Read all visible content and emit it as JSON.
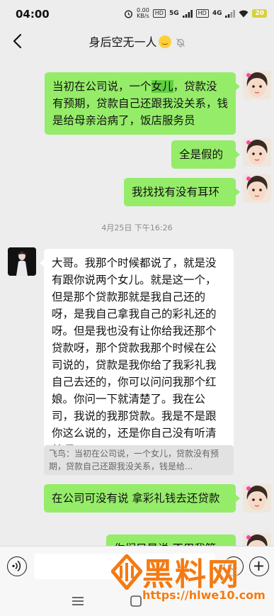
{
  "status": {
    "time": "04:00",
    "net_speed": "0.00",
    "net_unit": "KB/s",
    "hd1": "HD",
    "net_type": "5G",
    "hd2": "HD",
    "net_type2": "4G",
    "battery": "20"
  },
  "header": {
    "title": "身后空无一人",
    "back_icon": "chevron-left-icon",
    "mute_icon": "bell-off-icon"
  },
  "messages": [
    {
      "side": "me",
      "parts": [
        "当初在公司说，一个",
        "女儿",
        "，贷款没有预期，贷款自己还跟我没关系，钱是给母亲治病了，饭店服务员"
      ]
    },
    {
      "side": "me",
      "text": "全是假的"
    },
    {
      "side": "me",
      "text": "我找找有没有耳环"
    },
    {
      "side": "other",
      "text": "大哥。我那个时候都说了，就是没有跟你说两个女儿。就是这一个，但是那个贷款那就是我自己还的呀，是我自己拿我自己的彩礼还的呀。但是我也没有让你给我还那个贷款呀，那个贷款我那个时候在公司说的，贷款是我你给了我彩礼我自己去还的，你可以问问我那个红娘。你问一下就清楚了。我在公司，我说的我那贷款。我是不是跟你这么说的，还是你自己没有听清楚啊"
    },
    {
      "side": "me",
      "text": "在公司可没有说  拿彩礼钱去还贷款"
    },
    {
      "side": "me",
      "text": "你们只是说  不用我管"
    }
  ],
  "timestamp": "4月25日 下午16:26",
  "quote": "飞鸟：当初在公司说，一个女儿，贷款没有预期，贷款自己还跟我没关系，钱是给...",
  "watermark": {
    "brand": "黑料网",
    "url": "https://hlwe10.com"
  },
  "colors": {
    "my_bubble": "#95ec69",
    "other_bubble": "#ffffff",
    "background": "#ededed",
    "watermark": "#f47a12"
  }
}
